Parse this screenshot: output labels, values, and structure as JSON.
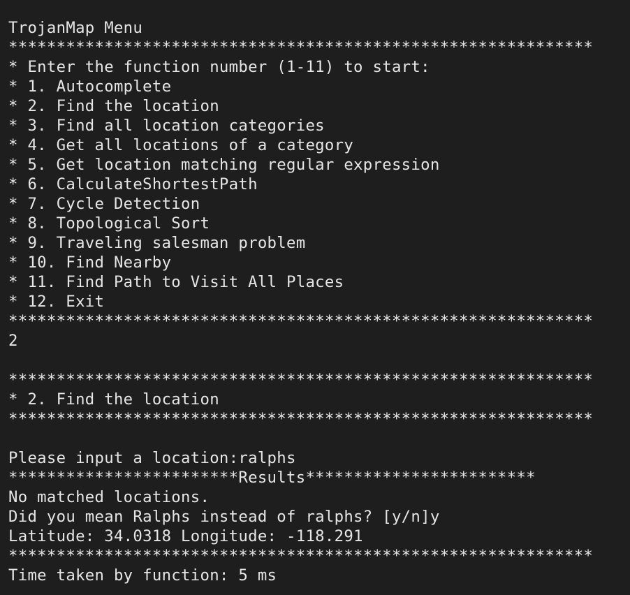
{
  "terminal": {
    "title": "TrojanMap Menu",
    "separator": "*************************************************************",
    "menu": {
      "prompt": "* Enter the function number (1-11) to start:",
      "items": [
        "* 1. Autocomplete",
        "* 2. Find the location",
        "* 3. Find all location categories",
        "* 4. Get all locations of a category",
        "* 5. Get location matching regular expression",
        "* 6. CalculateShortestPath",
        "* 7. Cycle Detection",
        "* 8. Topological Sort",
        "* 9. Traveling salesman problem",
        "* 10. Find Nearby",
        "* 11. Find Path to Visit All Places",
        "* 12. Exit"
      ]
    },
    "user_choice": "2",
    "section_header": "* 2. Find the location",
    "input_prompt": "Please input a location:",
    "input_value": "ralphs",
    "results_separator": "************************Results************************",
    "output": {
      "no_match": "No matched locations.",
      "suggestion_question": "Did you mean Ralphs instead of ralphs? [y/n]",
      "suggestion_answer": "y",
      "coordinates": "Latitude: 34.0318 Longitude: -118.291",
      "time_taken": "Time taken by function: 5 ms"
    }
  }
}
